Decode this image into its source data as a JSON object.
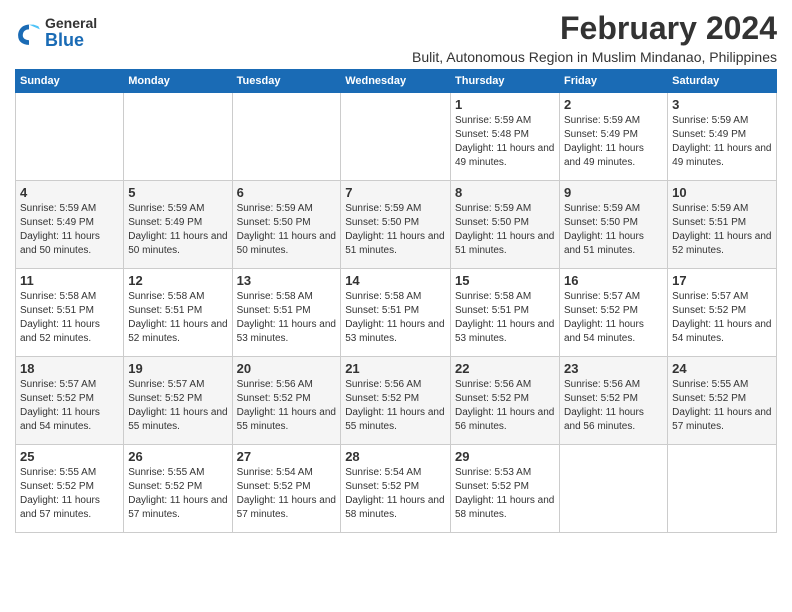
{
  "logo": {
    "general": "General",
    "blue": "Blue"
  },
  "title": "February 2024",
  "subtitle": "Bulit, Autonomous Region in Muslim Mindanao, Philippines",
  "columns": [
    "Sunday",
    "Monday",
    "Tuesday",
    "Wednesday",
    "Thursday",
    "Friday",
    "Saturday"
  ],
  "weeks": [
    [
      {
        "day": "",
        "info": ""
      },
      {
        "day": "",
        "info": ""
      },
      {
        "day": "",
        "info": ""
      },
      {
        "day": "",
        "info": ""
      },
      {
        "day": "1",
        "info": "Sunrise: 5:59 AM\nSunset: 5:48 PM\nDaylight: 11 hours and 49 minutes."
      },
      {
        "day": "2",
        "info": "Sunrise: 5:59 AM\nSunset: 5:49 PM\nDaylight: 11 hours and 49 minutes."
      },
      {
        "day": "3",
        "info": "Sunrise: 5:59 AM\nSunset: 5:49 PM\nDaylight: 11 hours and 49 minutes."
      }
    ],
    [
      {
        "day": "4",
        "info": "Sunrise: 5:59 AM\nSunset: 5:49 PM\nDaylight: 11 hours and 50 minutes."
      },
      {
        "day": "5",
        "info": "Sunrise: 5:59 AM\nSunset: 5:49 PM\nDaylight: 11 hours and 50 minutes."
      },
      {
        "day": "6",
        "info": "Sunrise: 5:59 AM\nSunset: 5:50 PM\nDaylight: 11 hours and 50 minutes."
      },
      {
        "day": "7",
        "info": "Sunrise: 5:59 AM\nSunset: 5:50 PM\nDaylight: 11 hours and 51 minutes."
      },
      {
        "day": "8",
        "info": "Sunrise: 5:59 AM\nSunset: 5:50 PM\nDaylight: 11 hours and 51 minutes."
      },
      {
        "day": "9",
        "info": "Sunrise: 5:59 AM\nSunset: 5:50 PM\nDaylight: 11 hours and 51 minutes."
      },
      {
        "day": "10",
        "info": "Sunrise: 5:59 AM\nSunset: 5:51 PM\nDaylight: 11 hours and 52 minutes."
      }
    ],
    [
      {
        "day": "11",
        "info": "Sunrise: 5:58 AM\nSunset: 5:51 PM\nDaylight: 11 hours and 52 minutes."
      },
      {
        "day": "12",
        "info": "Sunrise: 5:58 AM\nSunset: 5:51 PM\nDaylight: 11 hours and 52 minutes."
      },
      {
        "day": "13",
        "info": "Sunrise: 5:58 AM\nSunset: 5:51 PM\nDaylight: 11 hours and 53 minutes."
      },
      {
        "day": "14",
        "info": "Sunrise: 5:58 AM\nSunset: 5:51 PM\nDaylight: 11 hours and 53 minutes."
      },
      {
        "day": "15",
        "info": "Sunrise: 5:58 AM\nSunset: 5:51 PM\nDaylight: 11 hours and 53 minutes."
      },
      {
        "day": "16",
        "info": "Sunrise: 5:57 AM\nSunset: 5:52 PM\nDaylight: 11 hours and 54 minutes."
      },
      {
        "day": "17",
        "info": "Sunrise: 5:57 AM\nSunset: 5:52 PM\nDaylight: 11 hours and 54 minutes."
      }
    ],
    [
      {
        "day": "18",
        "info": "Sunrise: 5:57 AM\nSunset: 5:52 PM\nDaylight: 11 hours and 54 minutes."
      },
      {
        "day": "19",
        "info": "Sunrise: 5:57 AM\nSunset: 5:52 PM\nDaylight: 11 hours and 55 minutes."
      },
      {
        "day": "20",
        "info": "Sunrise: 5:56 AM\nSunset: 5:52 PM\nDaylight: 11 hours and 55 minutes."
      },
      {
        "day": "21",
        "info": "Sunrise: 5:56 AM\nSunset: 5:52 PM\nDaylight: 11 hours and 55 minutes."
      },
      {
        "day": "22",
        "info": "Sunrise: 5:56 AM\nSunset: 5:52 PM\nDaylight: 11 hours and 56 minutes."
      },
      {
        "day": "23",
        "info": "Sunrise: 5:56 AM\nSunset: 5:52 PM\nDaylight: 11 hours and 56 minutes."
      },
      {
        "day": "24",
        "info": "Sunrise: 5:55 AM\nSunset: 5:52 PM\nDaylight: 11 hours and 57 minutes."
      }
    ],
    [
      {
        "day": "25",
        "info": "Sunrise: 5:55 AM\nSunset: 5:52 PM\nDaylight: 11 hours and 57 minutes."
      },
      {
        "day": "26",
        "info": "Sunrise: 5:55 AM\nSunset: 5:52 PM\nDaylight: 11 hours and 57 minutes."
      },
      {
        "day": "27",
        "info": "Sunrise: 5:54 AM\nSunset: 5:52 PM\nDaylight: 11 hours and 57 minutes."
      },
      {
        "day": "28",
        "info": "Sunrise: 5:54 AM\nSunset: 5:52 PM\nDaylight: 11 hours and 58 minutes."
      },
      {
        "day": "29",
        "info": "Sunrise: 5:53 AM\nSunset: 5:52 PM\nDaylight: 11 hours and 58 minutes."
      },
      {
        "day": "",
        "info": ""
      },
      {
        "day": "",
        "info": ""
      }
    ]
  ]
}
